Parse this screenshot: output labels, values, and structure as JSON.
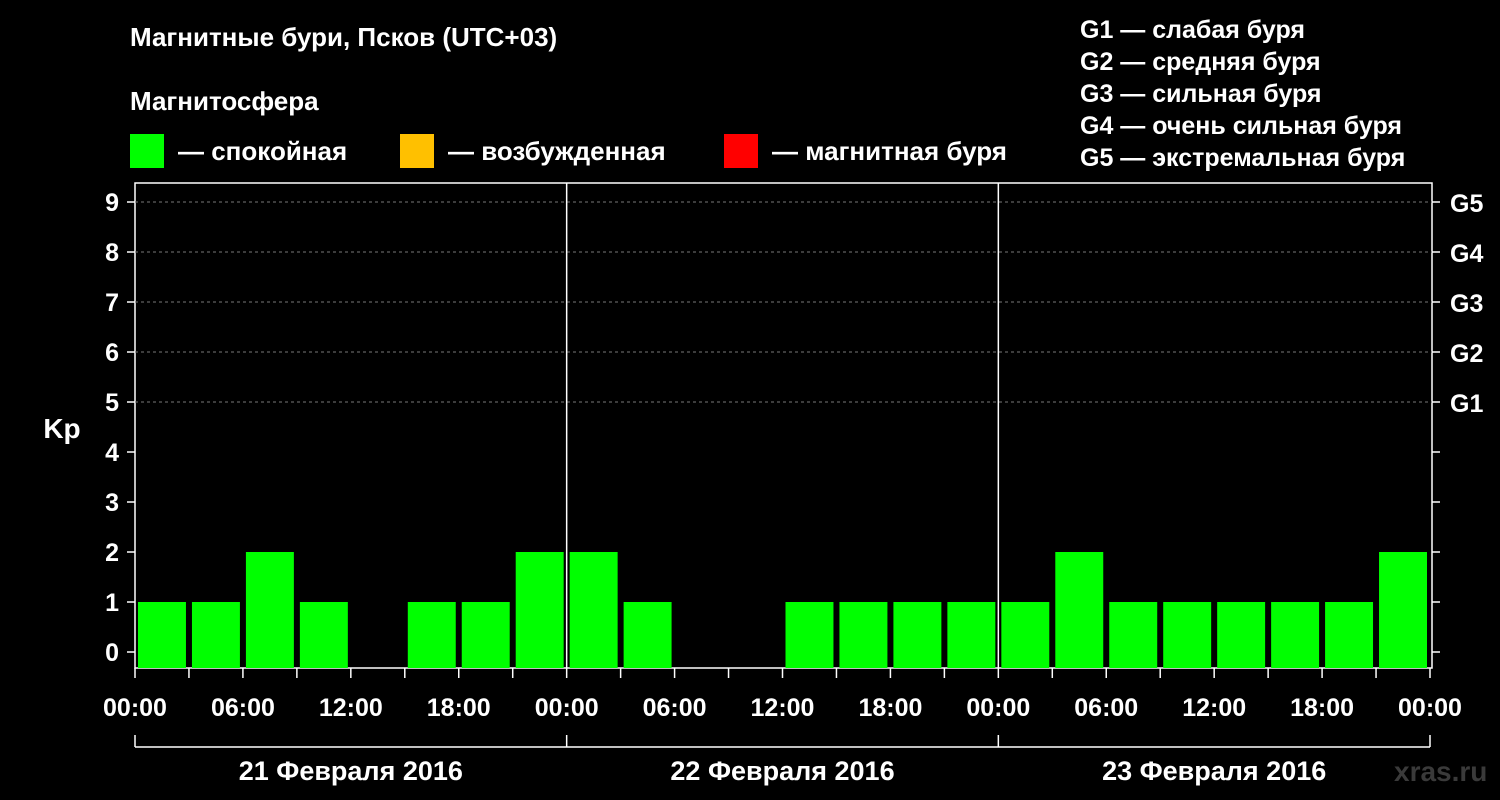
{
  "title": "Магнитные бури, Псков (UTC+03)",
  "subtitle": "Магнитосфера",
  "legend": [
    {
      "label": "— спокойная",
      "color": "#00ff00"
    },
    {
      "label": "— возбужденная",
      "color": "#ffc000"
    },
    {
      "label": "— магнитная буря",
      "color": "#ff0000"
    }
  ],
  "g_scale": [
    "G1 — слабая буря",
    "G2 — средняя буря",
    "G3 — сильная буря",
    "G4 — очень сильная буря",
    "G5 — экстремальная буря"
  ],
  "watermark": "xras.ru",
  "chart_data": {
    "type": "bar",
    "ylabel": "Kp",
    "ylim": [
      0,
      9
    ],
    "yticks": [
      "0",
      "1",
      "2",
      "3",
      "4",
      "5",
      "6",
      "7",
      "8",
      "9"
    ],
    "right_ticks": [
      {
        "value": 5,
        "label": "G1"
      },
      {
        "value": 6,
        "label": "G2"
      },
      {
        "value": 7,
        "label": "G3"
      },
      {
        "value": 8,
        "label": "G4"
      },
      {
        "value": 9,
        "label": "G5"
      }
    ],
    "xtick_labels": [
      "00:00",
      "06:00",
      "12:00",
      "18:00",
      "00:00",
      "06:00",
      "12:00",
      "18:00",
      "00:00",
      "06:00",
      "12:00",
      "18:00",
      "00:00"
    ],
    "days": [
      "21 Февраля 2016",
      "22 Февраля 2016",
      "23 Февраля 2016"
    ],
    "interval_hours": 3,
    "grid": "horizontal dashed at Kp 5–9",
    "bar_color": "#00ff00",
    "values": [
      1,
      1,
      2,
      1,
      0,
      1,
      1,
      2,
      2,
      1,
      0,
      0,
      1,
      1,
      1,
      1,
      1,
      2,
      1,
      1,
      1,
      1,
      1,
      2
    ]
  }
}
